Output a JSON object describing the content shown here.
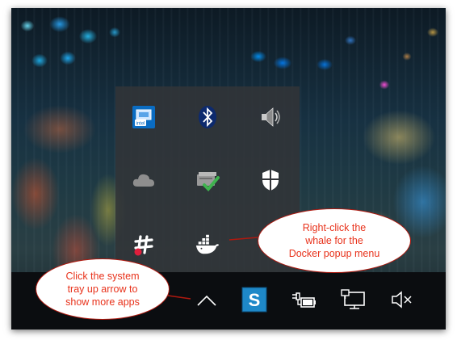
{
  "overflow_tray": {
    "icons": [
      {
        "name": "intel-graphics-icon",
        "row": 0,
        "col": 0
      },
      {
        "name": "bluetooth-icon",
        "row": 0,
        "col": 1
      },
      {
        "name": "speaker-icon",
        "row": 0,
        "col": 2
      },
      {
        "name": "onedrive-cloud-icon",
        "row": 1,
        "col": 0
      },
      {
        "name": "backup-check-icon",
        "row": 1,
        "col": 1
      },
      {
        "name": "windows-defender-shield-icon",
        "row": 1,
        "col": 2
      },
      {
        "name": "slack-icon",
        "row": 2,
        "col": 0
      },
      {
        "name": "docker-whale-icon",
        "row": 2,
        "col": 1
      }
    ]
  },
  "taskbar": {
    "icons": [
      "tray-up-arrow-icon",
      "snagit-icon",
      "power-battery-icon",
      "network-monitor-icon",
      "volume-muted-icon"
    ],
    "snagit_letter": "S"
  },
  "callouts": {
    "docker": {
      "lines": [
        "Right-click the",
        "whale for the",
        "Docker popup menu"
      ]
    },
    "tray": {
      "lines": [
        "Click the system",
        "tray up arrow to",
        "show more apps"
      ]
    }
  },
  "colors": {
    "callout_text": "#e8321b",
    "callout_border": "#b0190f",
    "taskbar": "#0b0d10",
    "tray_panel": "#323438",
    "snagit_blue": "#1e88c8",
    "defender_check": "#3fb34f"
  }
}
